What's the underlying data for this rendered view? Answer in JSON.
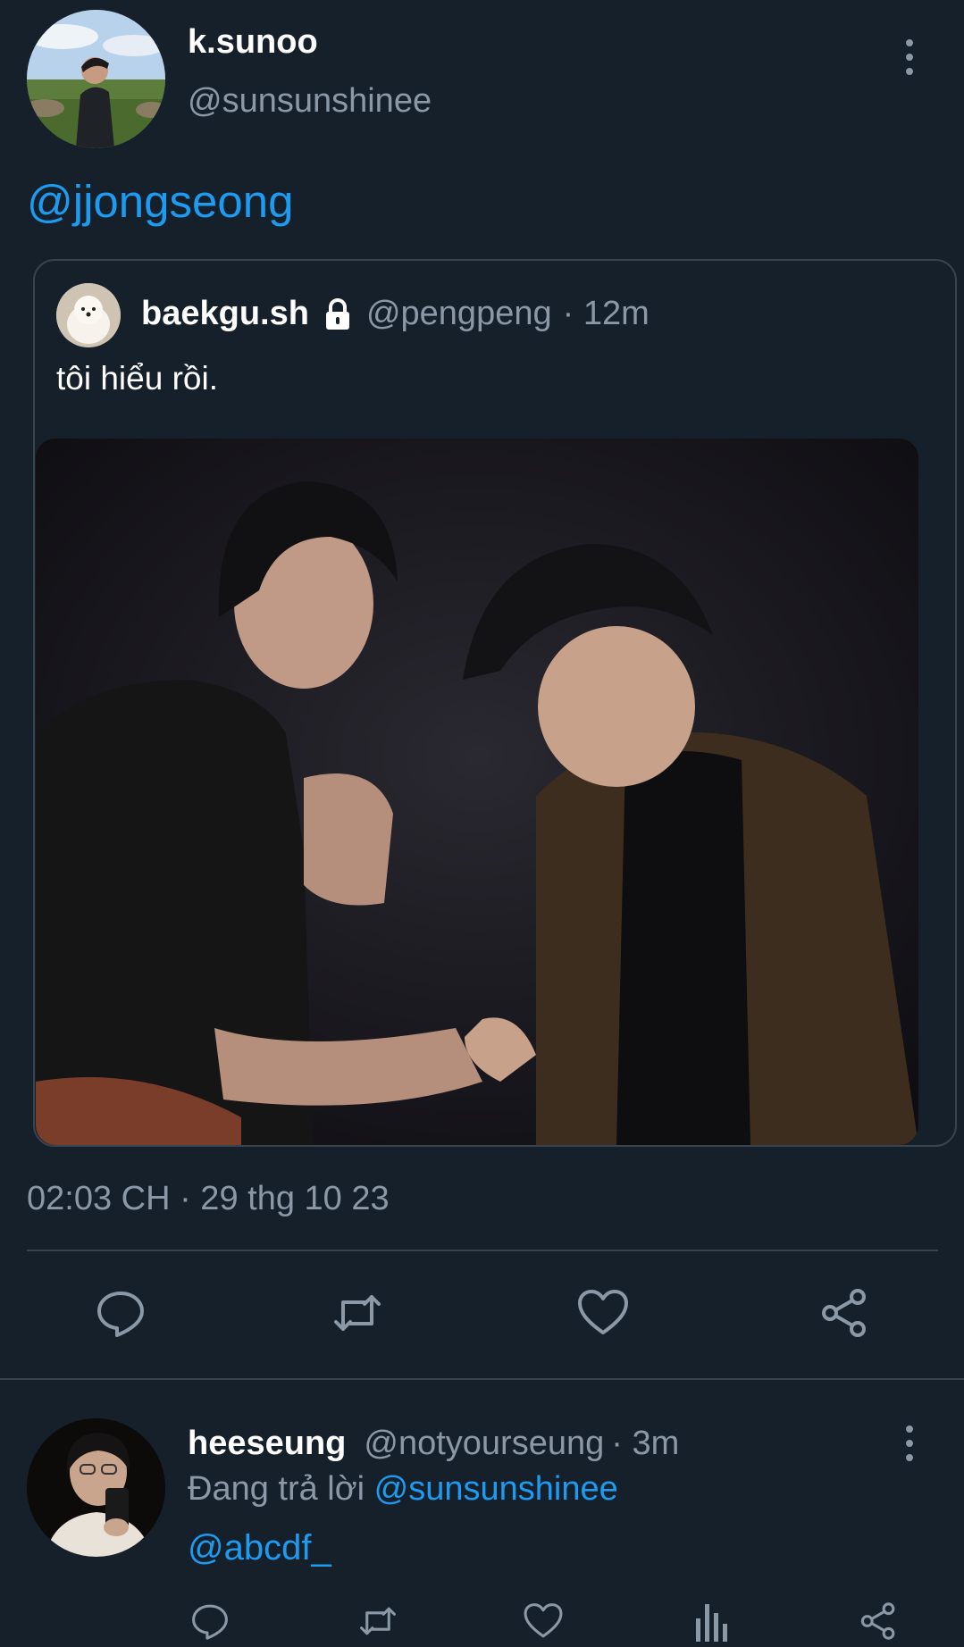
{
  "tweet": {
    "display_name": "k.sunoo",
    "handle": "@sunsunshinee",
    "text_mention": "@jjongseong",
    "timestamp": "02:03 CH · 29 thg 10 23"
  },
  "quote": {
    "display_name": "baekgu.sh",
    "handle": "@pengpeng",
    "time_suffix": "· 12m",
    "text": "tôi hiểu rồi."
  },
  "actions": [
    "reply-icon",
    "retweet-icon",
    "like-icon",
    "share-icon"
  ],
  "reply": {
    "display_name": "heeseung",
    "handle": "@notyourseung",
    "time_suffix": "· 3m",
    "replying_prefix": "Đang trả lời",
    "replying_to": "@sunsunshinee",
    "text_mention": "@abcdf_",
    "actions": [
      "reply-icon",
      "retweet-icon",
      "like-icon",
      "analytics-icon",
      "share-icon"
    ]
  },
  "colors": {
    "background": "#15202b",
    "accent": "#1d9bf0",
    "secondary_text": "#8b98a5",
    "border": "#38444d"
  }
}
